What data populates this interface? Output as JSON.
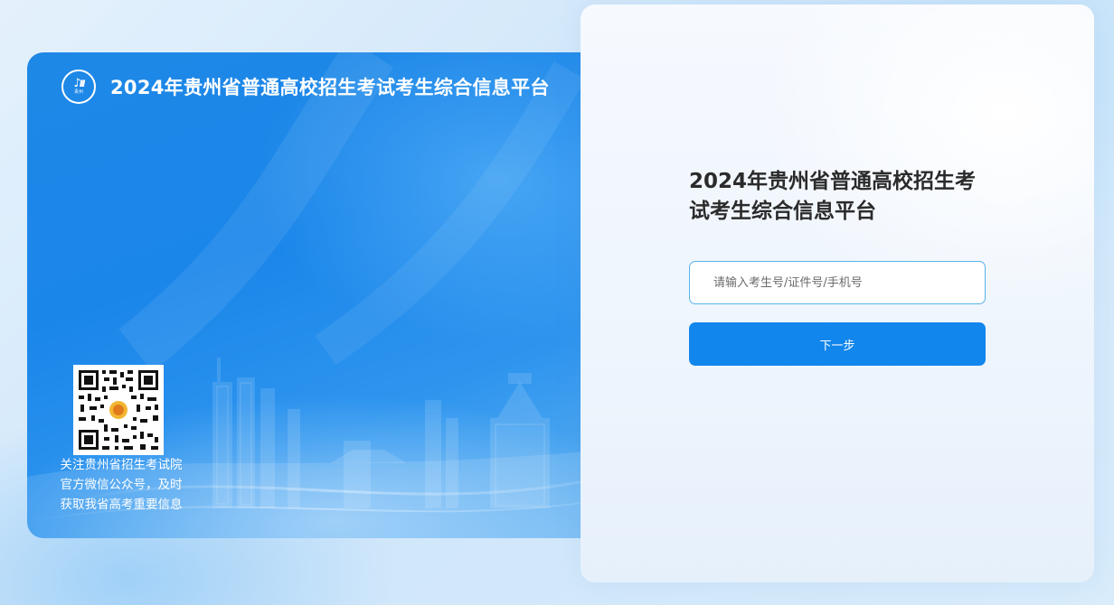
{
  "banner": {
    "title": "2024年贵州省普通高校招生考试考生综合信息平台",
    "logo": {
      "icon": "guizhou-exam-logo-icon",
      "text": "贵州"
    },
    "qr": {
      "icon": "wechat-qr-code-icon",
      "caption_lines": [
        "关注贵州省招生考试院",
        "官方微信公众号，及时",
        "获取我省高考重要信息"
      ]
    }
  },
  "login": {
    "title": "2024年贵州省普通高校招生考试考生综合信息平台",
    "input": {
      "value": "",
      "placeholder": "请输入考生号/证件号/手机号"
    },
    "next_label": "下一步"
  },
  "colors": {
    "accent": "#1186ec",
    "input_border": "#58b3e8",
    "banner_blue": "#1e88e6",
    "title_text": "#2b2b2b"
  }
}
